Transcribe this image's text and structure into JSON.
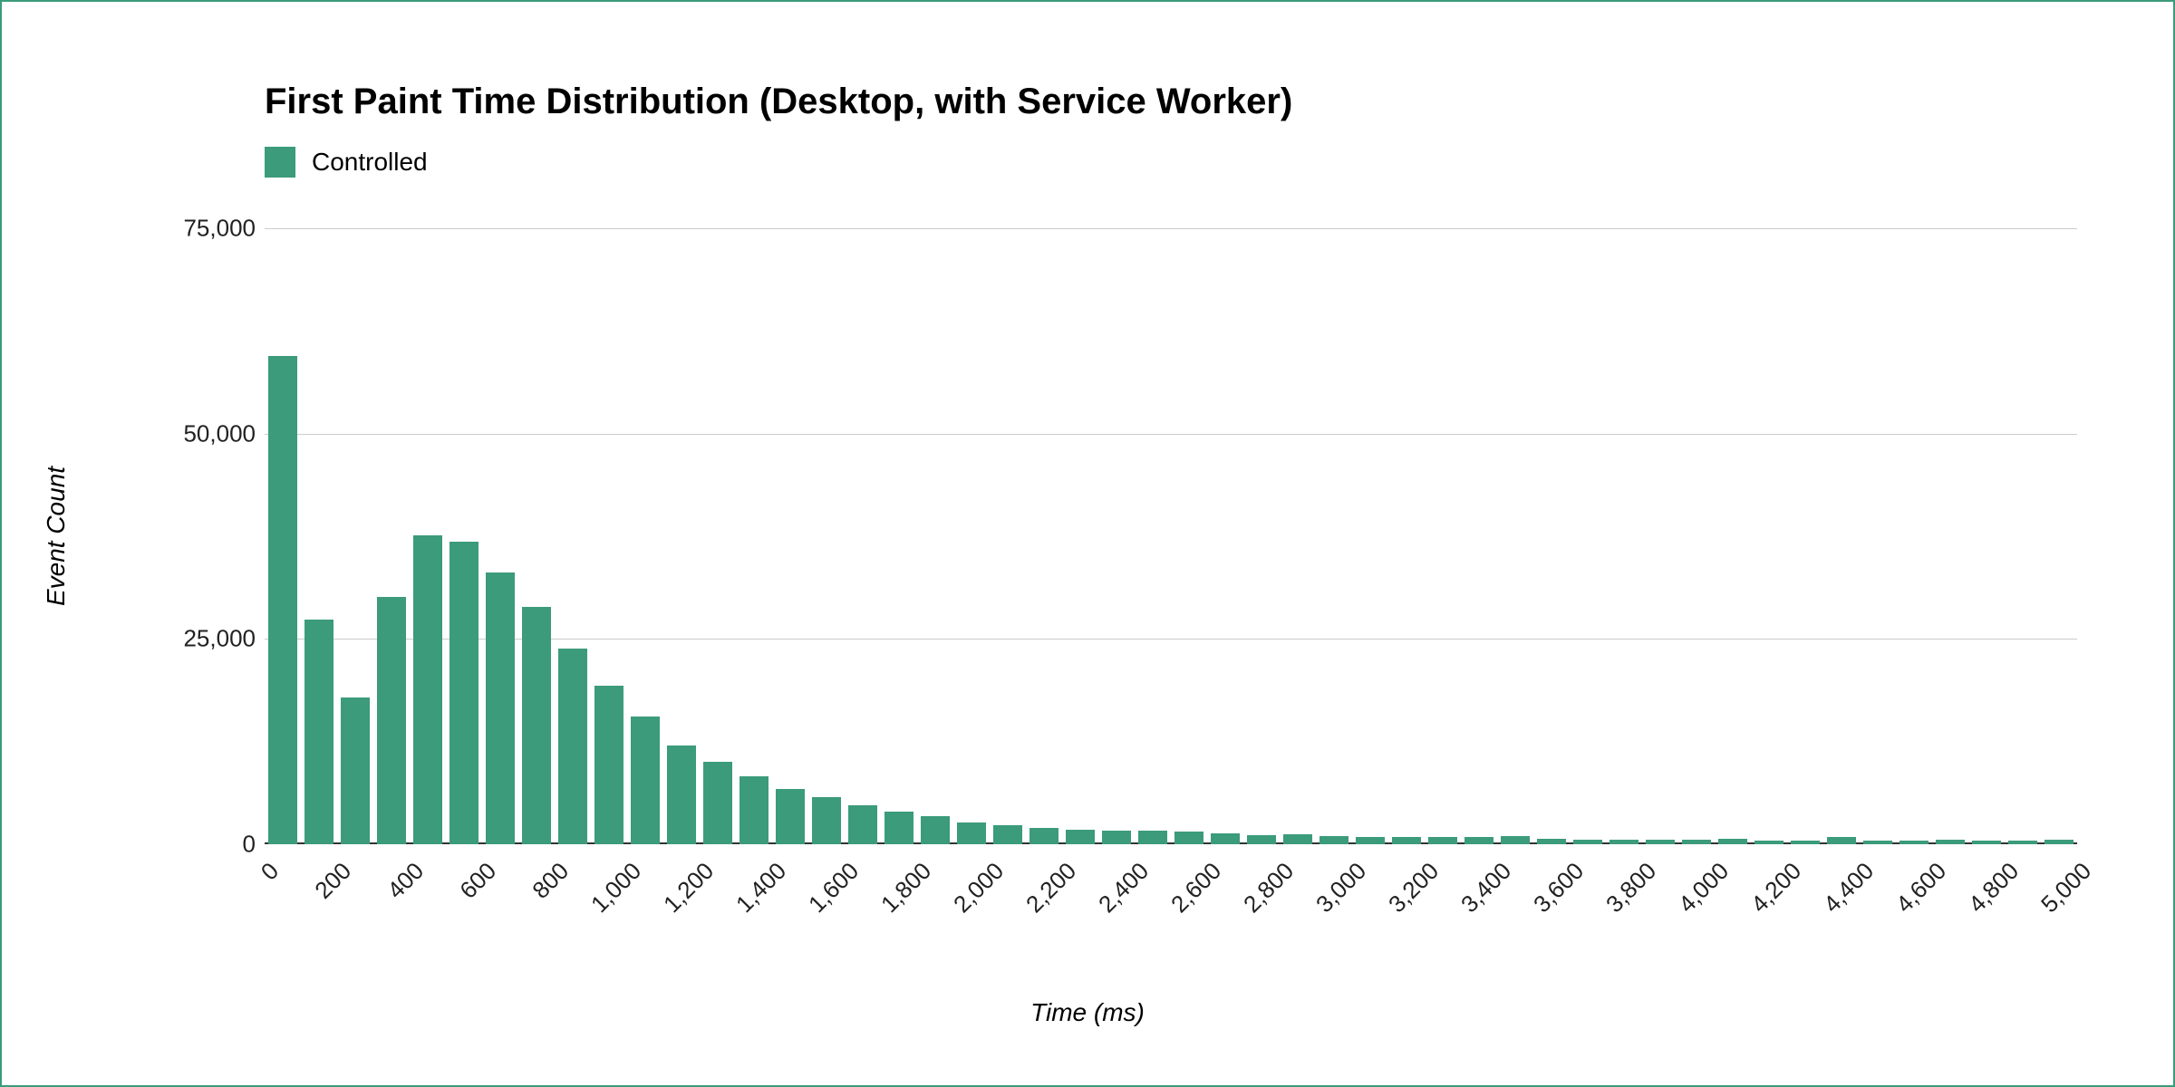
{
  "title": "First Paint Time Distribution (Desktop, with Service Worker)",
  "legend": {
    "label": "Controlled"
  },
  "ylabel": "Event Count",
  "xlabel": "Time (ms)",
  "color": "#3b9b7a",
  "chart_data": {
    "type": "bar",
    "title": "First Paint Time Distribution (Desktop, with Service Worker)",
    "xlabel": "Time (ms)",
    "ylabel": "Event Count",
    "ylim": [
      0,
      75000
    ],
    "y_ticks": [
      0,
      25000,
      50000,
      75000
    ],
    "y_tick_labels": [
      "0",
      "25,000",
      "50,000",
      "75,000"
    ],
    "x_tick_values": [
      0,
      200,
      400,
      600,
      800,
      1000,
      1200,
      1400,
      1600,
      1800,
      2000,
      2200,
      2400,
      2600,
      2800,
      3000,
      3200,
      3400,
      3600,
      3800,
      4000,
      4200,
      4400,
      4600,
      4800,
      5000
    ],
    "x_tick_labels": [
      "0",
      "200",
      "400",
      "600",
      "800",
      "1,000",
      "1,200",
      "1,400",
      "1,600",
      "1,800",
      "2,000",
      "2,200",
      "2,400",
      "2,600",
      "2,800",
      "3,000",
      "3,200",
      "3,400",
      "3,600",
      "3,800",
      "4,000",
      "4,200",
      "4,400",
      "4,600",
      "4,800",
      "5,000"
    ],
    "categories": [
      0,
      100,
      200,
      300,
      400,
      500,
      600,
      700,
      800,
      900,
      1000,
      1100,
      1200,
      1300,
      1400,
      1500,
      1600,
      1700,
      1800,
      1900,
      2000,
      2100,
      2200,
      2300,
      2400,
      2500,
      2600,
      2700,
      2800,
      2900,
      3000,
      3100,
      3200,
      3300,
      3400,
      3500,
      3600,
      3700,
      3800,
      3900,
      4000,
      4100,
      4200,
      4300,
      4400,
      4500,
      4600,
      4700,
      4800,
      4900
    ],
    "series": [
      {
        "name": "Controlled",
        "values": [
          59500,
          27400,
          17900,
          30100,
          37600,
          36800,
          33100,
          28900,
          23800,
          19300,
          15500,
          12000,
          10000,
          8300,
          6700,
          5700,
          4700,
          4000,
          3400,
          2600,
          2300,
          2000,
          1800,
          1700,
          1700,
          1600,
          1300,
          1100,
          1200,
          1000,
          900,
          900,
          900,
          900,
          1000,
          700,
          600,
          600,
          600,
          600,
          700,
          400,
          400,
          900,
          400,
          400,
          500,
          400,
          400,
          500
        ]
      }
    ]
  }
}
